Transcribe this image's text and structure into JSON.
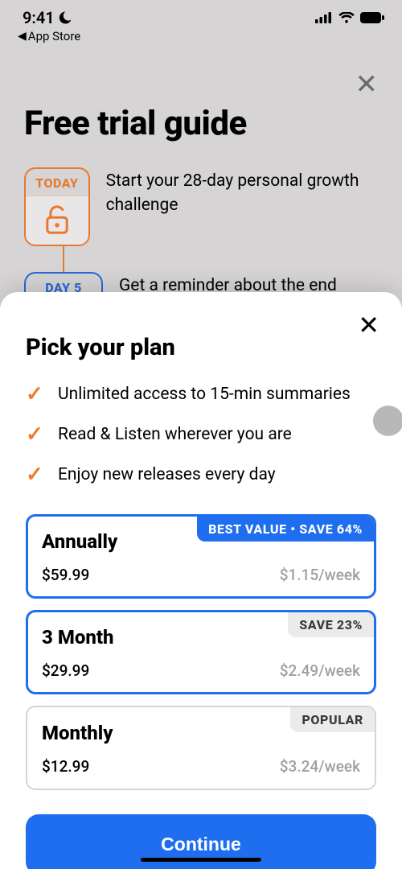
{
  "status": {
    "time": "9:41",
    "back_app": "App Store"
  },
  "bg": {
    "title": "Free trial guide",
    "timeline": {
      "today_label": "TODAY",
      "today_text": "Start your 28-day personal growth challenge",
      "day5_label": "DAY 5",
      "day5_text": "Get a reminder about the end"
    }
  },
  "sheet": {
    "title": "Pick your plan",
    "benefits": [
      "Unlimited access to 15-min summaries",
      "Read & Listen wherever you are",
      "Enjoy new releases every day"
    ],
    "plans": [
      {
        "name": "Annually",
        "price": "$59.99",
        "weekly": "$1.15/week",
        "badge": "BEST VALUE • SAVE 64%",
        "badge_style": "blue",
        "selected": true
      },
      {
        "name": "3 Month",
        "price": "$29.99",
        "weekly": "$2.49/week",
        "badge": "SAVE 23%",
        "badge_style": "grey",
        "selected": true
      },
      {
        "name": "Monthly",
        "price": "$12.99",
        "weekly": "$3.24/week",
        "badge": "POPULAR",
        "badge_style": "grey",
        "selected": false
      }
    ],
    "continue": "Continue"
  }
}
